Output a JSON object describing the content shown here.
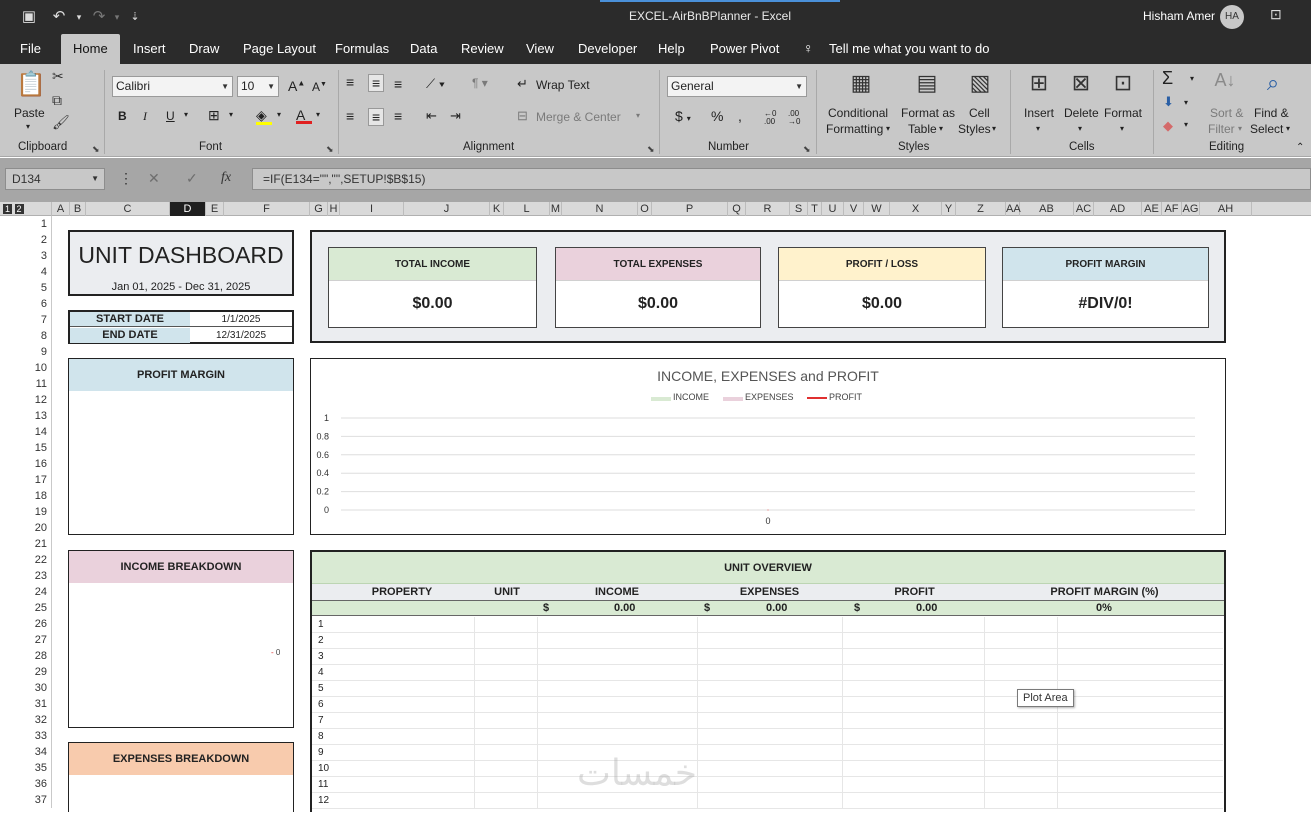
{
  "window": {
    "title": "EXCEL-AirBnBPlanner  -  Excel",
    "user_name": "Hisham Amer",
    "user_initials": "HA"
  },
  "menu_tabs": [
    "File",
    "Home",
    "Insert",
    "Draw",
    "Page Layout",
    "Formulas",
    "Data",
    "Review",
    "View",
    "Developer",
    "Help",
    "Power Pivot"
  ],
  "tell_me": "Tell me what you want to do",
  "ribbon": {
    "clipboard": {
      "label": "Clipboard",
      "paste": "Paste"
    },
    "font": {
      "label": "Font",
      "name": "Calibri",
      "size": "10"
    },
    "alignment": {
      "label": "Alignment",
      "wrap": "Wrap Text",
      "merge": "Merge & Center"
    },
    "number": {
      "label": "Number",
      "format": "General"
    },
    "styles": {
      "label": "Styles",
      "cond1": "Conditional",
      "cond2": "Formatting",
      "fmt1": "Format as",
      "fmt2": "Table",
      "cell1": "Cell",
      "cell2": "Styles"
    },
    "cells": {
      "label": "Cells",
      "insert": "Insert",
      "delete": "Delete",
      "format": "Format"
    },
    "editing": {
      "label": "Editing",
      "sort1": "Sort &",
      "sort2": "Filter",
      "find1": "Find &",
      "find2": "Select"
    }
  },
  "formula_bar": {
    "name_box": "D134",
    "formula": "=IF(E134=\"\",\"\",SETUP!$B$15)"
  },
  "columns": [
    "A",
    "B",
    "C",
    "D",
    "E",
    "F",
    "G",
    "H",
    "I",
    "J",
    "K",
    "L",
    "M",
    "N",
    "O",
    "P",
    "Q",
    "R",
    "S",
    "T",
    "U",
    "V",
    "W",
    "X",
    "Y",
    "Z",
    "AA",
    "AB",
    "AC",
    "AD",
    "AE",
    "AF",
    "AG",
    "AH"
  ],
  "selected_column": "D",
  "outline_levels": [
    "1",
    "2"
  ],
  "rows": [
    "1",
    "2",
    "3",
    "4",
    "5",
    "6",
    "7",
    "8",
    "9",
    "10",
    "11",
    "12",
    "13",
    "14",
    "15",
    "16",
    "17",
    "18",
    "19",
    "20",
    "21",
    "22",
    "23",
    "24",
    "25",
    "26",
    "27",
    "28",
    "29",
    "30",
    "31",
    "32",
    "33",
    "34",
    "35",
    "36",
    "37"
  ],
  "dashboard": {
    "title": "UNIT DASHBOARD",
    "date_range": "Jan 01, 2025 - Dec 31, 2025",
    "start_label": "START DATE",
    "start_value": "1/1/2025",
    "end_label": "END DATE",
    "end_value": "12/31/2025"
  },
  "kpis": [
    {
      "label": "TOTAL INCOME",
      "value": "$0.00",
      "color": "#d9ead3"
    },
    {
      "label": "TOTAL EXPENSES",
      "value": "$0.00",
      "color": "#ead1dc"
    },
    {
      "label": "PROFIT / LOSS",
      "value": "$0.00",
      "color": "#fff2cc"
    },
    {
      "label": "PROFIT MARGIN",
      "value": "#DIV/0!",
      "color": "#d0e4ec"
    }
  ],
  "side_panels": {
    "profit_margin": {
      "title": "PROFIT MARGIN",
      "color": "#d0e4ec"
    },
    "income_breakdown": {
      "title": "INCOME BREAKDOWN",
      "color": "#ead1dc",
      "zero_label": "0"
    },
    "expenses_breakdown": {
      "title": "EXPENSES BREAKDOWN",
      "color": "#f8cbad"
    }
  },
  "chart_data": {
    "type": "line",
    "title": "INCOME, EXPENSES and PROFIT",
    "legend_position": "top",
    "series": [
      {
        "name": "INCOME",
        "color": "#d9ead3",
        "values": [
          0
        ]
      },
      {
        "name": "EXPENSES",
        "color": "#ead1dc",
        "values": [
          0
        ]
      },
      {
        "name": "PROFIT",
        "color": "#e03030",
        "values": [
          0
        ]
      }
    ],
    "x": [
      "0"
    ],
    "yticks": [
      "1",
      "0.8",
      "0.6",
      "0.4",
      "0.2",
      "0"
    ],
    "ylim": [
      0,
      1
    ],
    "grid": true
  },
  "unit_overview": {
    "title": "UNIT OVERVIEW",
    "color": "#d9ead3",
    "headers": [
      "PROPERTY",
      "UNIT",
      "INCOME",
      "EXPENSES",
      "PROFIT",
      "PROFIT MARGIN (%)"
    ],
    "currency": "$",
    "totals": {
      "income": "0.00",
      "expenses": "0.00",
      "profit": "0.00",
      "margin": "0%"
    },
    "row_numbers": [
      "1",
      "2",
      "3",
      "4",
      "5",
      "6",
      "7",
      "8",
      "9",
      "10",
      "11",
      "12"
    ]
  },
  "tooltip": "Plot Area",
  "watermark": "خمسات"
}
